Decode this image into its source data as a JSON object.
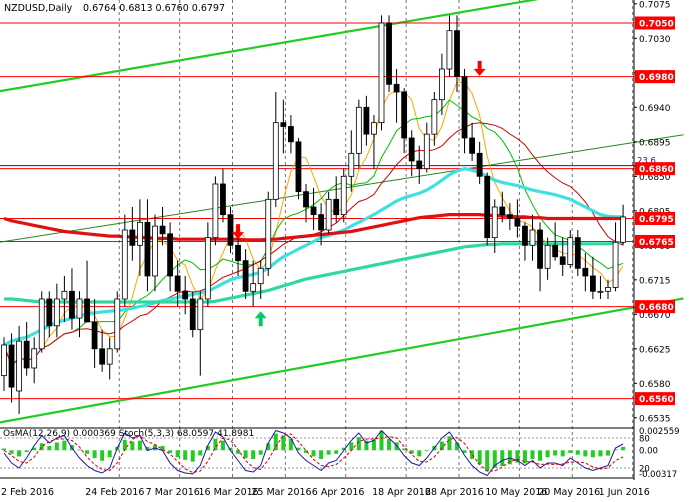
{
  "chart_data": {
    "type": "candlestick",
    "symbol_label": "NZDUSD,Daily",
    "ohlc_label": "0.6764 0.6813 0.6760 0.6797",
    "price_axis": {
      "range": [
        0.6523,
        0.708
      ],
      "ticks": [
        "0.7075",
        "0.7030",
        "0.6985",
        "0.6940",
        "0.6895",
        "0.6850",
        "0.6805",
        "0.6760",
        "0.6715",
        "0.6670",
        "0.6625",
        "0.6580",
        "0.6535"
      ],
      "tick_values": [
        0.7075,
        0.703,
        0.6985,
        0.694,
        0.6895,
        0.685,
        0.6805,
        0.676,
        0.6715,
        0.667,
        0.6625,
        0.658,
        0.6535
      ]
    },
    "date_axis": {
      "labels": [
        "2 Feb 2016",
        "24 Feb 2016",
        "7 Mar 2016",
        "16 Mar 2016",
        "25 Mar 2016",
        "6 Apr 2016",
        "18 Apr 2016",
        "28 Apr 2016",
        "10 May 2016",
        "20 May 2016",
        "1 Jun 2016"
      ],
      "label_bars": [
        0,
        15,
        23,
        30,
        37,
        45,
        53,
        60,
        68,
        75,
        83
      ]
    },
    "levels": [
      {
        "value": 0.705,
        "label": "0.7050",
        "color": "#ff0000"
      },
      {
        "value": 0.698,
        "label": "0.6980",
        "color": "#ff0000"
      },
      {
        "value": 0.686,
        "label": "0.6860",
        "color": "#ff0000"
      },
      {
        "value": 0.6795,
        "label": "0.6795",
        "color": "#ff0000"
      },
      {
        "value": 0.6765,
        "label": "0.6765",
        "color": "#ff0000"
      },
      {
        "value": 0.668,
        "label": "0.6680",
        "color": "#ff0000"
      },
      {
        "value": 0.656,
        "label": "0.6560",
        "color": "#ff0000"
      }
    ],
    "fibo": {
      "value": 0.6864,
      "label": "23.6",
      "color": "#1a1aa8"
    },
    "signals": [
      {
        "type": "sell",
        "bar": 31,
        "value": 0.6772,
        "color": "#ff0000"
      },
      {
        "type": "sell",
        "bar": 63,
        "value": 0.6985,
        "color": "#ff0000"
      },
      {
        "type": "buy",
        "bar": 34,
        "value": 0.667,
        "color": "#00cc66"
      }
    ],
    "candles": [
      [
        0.659,
        0.664,
        0.657,
        0.663
      ],
      [
        0.663,
        0.6645,
        0.6555,
        0.6575
      ],
      [
        0.657,
        0.6655,
        0.654,
        0.6635
      ],
      [
        0.6635,
        0.666,
        0.659,
        0.66
      ],
      [
        0.66,
        0.664,
        0.658,
        0.6625
      ],
      [
        0.6625,
        0.67,
        0.662,
        0.669
      ],
      [
        0.669,
        0.67,
        0.664,
        0.6655
      ],
      [
        0.6655,
        0.671,
        0.664,
        0.669
      ],
      [
        0.669,
        0.672,
        0.666,
        0.67
      ],
      [
        0.67,
        0.673,
        0.665,
        0.6665
      ],
      [
        0.6665,
        0.67,
        0.664,
        0.669
      ],
      [
        0.669,
        0.674,
        0.666,
        0.666
      ],
      [
        0.666,
        0.669,
        0.66,
        0.6625
      ],
      [
        0.6625,
        0.665,
        0.6595,
        0.6605
      ],
      [
        0.6605,
        0.664,
        0.6585,
        0.6625
      ],
      [
        0.6625,
        0.67,
        0.662,
        0.669
      ],
      [
        0.669,
        0.68,
        0.668,
        0.678
      ],
      [
        0.678,
        0.681,
        0.674,
        0.676
      ],
      [
        0.676,
        0.682,
        0.672,
        0.679
      ],
      [
        0.679,
        0.682,
        0.67,
        0.672
      ],
      [
        0.672,
        0.68,
        0.67,
        0.6785
      ],
      [
        0.6785,
        0.681,
        0.676,
        0.6775
      ],
      [
        0.6775,
        0.679,
        0.67,
        0.672
      ],
      [
        0.672,
        0.674,
        0.668,
        0.67
      ],
      [
        0.67,
        0.672,
        0.667,
        0.669
      ],
      [
        0.669,
        0.67,
        0.664,
        0.665
      ],
      [
        0.665,
        0.67,
        0.659,
        0.669
      ],
      [
        0.669,
        0.679,
        0.668,
        0.677
      ],
      [
        0.677,
        0.685,
        0.676,
        0.684
      ],
      [
        0.684,
        0.686,
        0.679,
        0.68
      ],
      [
        0.68,
        0.681,
        0.675,
        0.676
      ],
      [
        0.676,
        0.678,
        0.672,
        0.674
      ],
      [
        0.674,
        0.6755,
        0.669,
        0.67
      ],
      [
        0.67,
        0.674,
        0.668,
        0.671
      ],
      [
        0.671,
        0.674,
        0.669,
        0.673
      ],
      [
        0.673,
        0.683,
        0.672,
        0.682
      ],
      [
        0.682,
        0.696,
        0.681,
        0.692
      ],
      [
        0.692,
        0.695,
        0.688,
        0.6915
      ],
      [
        0.6915,
        0.693,
        0.688,
        0.6895
      ],
      [
        0.6895,
        0.69,
        0.682,
        0.683
      ],
      [
        0.683,
        0.684,
        0.679,
        0.681
      ],
      [
        0.681,
        0.6835,
        0.678,
        0.68
      ],
      [
        0.68,
        0.6815,
        0.676,
        0.678
      ],
      [
        0.678,
        0.683,
        0.6775,
        0.682
      ],
      [
        0.682,
        0.685,
        0.679,
        0.68
      ],
      [
        0.68,
        0.686,
        0.679,
        0.685
      ],
      [
        0.685,
        0.691,
        0.683,
        0.688
      ],
      [
        0.688,
        0.695,
        0.686,
        0.694
      ],
      [
        0.694,
        0.6955,
        0.689,
        0.6905
      ],
      [
        0.6905,
        0.693,
        0.686,
        0.692
      ],
      [
        0.692,
        0.706,
        0.691,
        0.705
      ],
      [
        0.705,
        0.706,
        0.696,
        0.697
      ],
      [
        0.697,
        0.699,
        0.692,
        0.696
      ],
      [
        0.696,
        0.6965,
        0.688,
        0.69
      ],
      [
        0.69,
        0.691,
        0.685,
        0.687
      ],
      [
        0.687,
        0.689,
        0.684,
        0.686
      ],
      [
        0.686,
        0.692,
        0.6855,
        0.6905
      ],
      [
        0.6905,
        0.696,
        0.689,
        0.695
      ],
      [
        0.695,
        0.701,
        0.693,
        0.699
      ],
      [
        0.699,
        0.706,
        0.698,
        0.704
      ],
      [
        0.704,
        0.706,
        0.696,
        0.698
      ],
      [
        0.698,
        0.699,
        0.688,
        0.69
      ],
      [
        0.69,
        0.692,
        0.687,
        0.688
      ],
      [
        0.688,
        0.6895,
        0.684,
        0.685
      ],
      [
        0.685,
        0.6855,
        0.676,
        0.677
      ],
      [
        0.677,
        0.682,
        0.675,
        0.681
      ],
      [
        0.681,
        0.683,
        0.679,
        0.68
      ],
      [
        0.68,
        0.6815,
        0.678,
        0.6795
      ],
      [
        0.6795,
        0.682,
        0.677,
        0.6785
      ],
      [
        0.6785,
        0.679,
        0.674,
        0.676
      ],
      [
        0.676,
        0.68,
        0.674,
        0.678
      ],
      [
        0.678,
        0.679,
        0.67,
        0.673
      ],
      [
        0.673,
        0.677,
        0.6715,
        0.676
      ],
      [
        0.676,
        0.679,
        0.674,
        0.6745
      ],
      [
        0.6745,
        0.677,
        0.672,
        0.6735
      ],
      [
        0.6735,
        0.678,
        0.673,
        0.677
      ],
      [
        0.677,
        0.678,
        0.672,
        0.673
      ],
      [
        0.673,
        0.675,
        0.67,
        0.672
      ],
      [
        0.672,
        0.6745,
        0.669,
        0.67
      ],
      [
        0.67,
        0.672,
        0.669,
        0.67
      ],
      [
        0.67,
        0.6715,
        0.669,
        0.6705
      ],
      [
        0.6705,
        0.679,
        0.67,
        0.6764
      ],
      [
        0.6764,
        0.6813,
        0.676,
        0.6797
      ]
    ],
    "ma_series": [
      {
        "color": "#ffa500",
        "period": 5
      },
      {
        "color": "#00c000",
        "period": 10
      },
      {
        "color": "#d00000",
        "period": 20
      },
      {
        "color": "#40e0e0",
        "period": 50,
        "points": [
          0.663,
          0.6635,
          0.6638,
          0.664,
          0.6645,
          0.665,
          0.6655,
          0.666,
          0.6662,
          0.6665,
          0.6668,
          0.667,
          0.6672,
          0.6673,
          0.6674,
          0.6675,
          0.6676,
          0.6678,
          0.668,
          0.6682,
          0.6685,
          0.6688,
          0.669,
          0.6692,
          0.6694,
          0.6696,
          0.6698,
          0.67,
          0.6705,
          0.671,
          0.6715,
          0.6718,
          0.672,
          0.6722,
          0.6725,
          0.673,
          0.6738,
          0.6745,
          0.675,
          0.6755,
          0.676,
          0.6765,
          0.677,
          0.6773,
          0.6776,
          0.678,
          0.6785,
          0.679,
          0.6795,
          0.68,
          0.6806,
          0.6812,
          0.6818,
          0.6822,
          0.6825,
          0.6828,
          0.6832,
          0.6838,
          0.6845,
          0.6852,
          0.6857,
          0.686,
          0.6858,
          0.6855,
          0.685,
          0.6845,
          0.6842,
          0.684,
          0.6838,
          0.6835,
          0.6832,
          0.683,
          0.6828,
          0.6826,
          0.6823,
          0.682,
          0.6815,
          0.681,
          0.6805,
          0.68,
          0.6798,
          0.6797,
          0.6797
        ]
      },
      {
        "color": "#30d8a0",
        "period": 100,
        "points": [
          0.669,
          0.669,
          0.6689,
          0.6688,
          0.6687,
          0.6686,
          0.6686,
          0.6686,
          0.6686,
          0.6686,
          0.6686,
          0.6686,
          0.6686,
          0.6686,
          0.6686,
          0.6686,
          0.6686,
          0.6686,
          0.6686,
          0.6686,
          0.6686,
          0.6686,
          0.6686,
          0.6686,
          0.6686,
          0.6686,
          0.6686,
          0.6686,
          0.6687,
          0.6689,
          0.6691,
          0.6693,
          0.6695,
          0.6697,
          0.6699,
          0.6701,
          0.6704,
          0.6707,
          0.671,
          0.6713,
          0.6716,
          0.6718,
          0.672,
          0.6722,
          0.6724,
          0.6726,
          0.6728,
          0.673,
          0.6732,
          0.6734,
          0.6736,
          0.6738,
          0.674,
          0.6742,
          0.6744,
          0.6746,
          0.6748,
          0.675,
          0.6752,
          0.6754,
          0.6756,
          0.6758,
          0.6759,
          0.676,
          0.6761,
          0.6761,
          0.6762,
          0.6762,
          0.6762,
          0.6762,
          0.6762,
          0.6762,
          0.6762,
          0.6762,
          0.6762,
          0.6762,
          0.6762,
          0.6762,
          0.6762,
          0.6762,
          0.6762,
          0.6763,
          0.6764
        ]
      },
      {
        "color": "#e01010",
        "period": 200,
        "points": [
          0.6795,
          0.6792,
          0.679,
          0.6788,
          0.6786,
          0.6784,
          0.6782,
          0.678,
          0.6778,
          0.6777,
          0.6776,
          0.6775,
          0.6774,
          0.6773,
          0.6772,
          0.6772,
          0.6771,
          0.6771,
          0.677,
          0.677,
          0.6769,
          0.6769,
          0.6769,
          0.6768,
          0.6768,
          0.6768,
          0.6768,
          0.6768,
          0.6768,
          0.6768,
          0.6768,
          0.6768,
          0.6767,
          0.6767,
          0.6767,
          0.6768,
          0.6768,
          0.6769,
          0.677,
          0.6771,
          0.6772,
          0.6773,
          0.6774,
          0.6775,
          0.6776,
          0.6777,
          0.6778,
          0.678,
          0.6782,
          0.6784,
          0.6786,
          0.6788,
          0.679,
          0.6792,
          0.6794,
          0.6796,
          0.6797,
          0.6798,
          0.6799,
          0.68,
          0.68,
          0.68,
          0.68,
          0.68,
          0.6799,
          0.6799,
          0.6798,
          0.6798,
          0.6797,
          0.6797,
          0.6796,
          0.6796,
          0.6795,
          0.6795,
          0.6795,
          0.6795,
          0.6795,
          0.6795,
          0.6795,
          0.6795,
          0.6795,
          0.6795,
          0.6795
        ]
      }
    ],
    "channel_lines": [
      {
        "name": "upper",
        "color": "#22cc22",
        "from": [
          0,
          0.6962
        ],
        "to": [
          70,
          0.708
        ]
      },
      {
        "name": "lower",
        "color": "#22cc22",
        "from": [
          0,
          0.653
        ],
        "to": [
          84,
          0.668
        ]
      },
      {
        "name": "mid",
        "color": "#228822",
        "from": [
          0,
          0.6765
        ],
        "to": [
          84,
          0.6895
        ]
      }
    ],
    "indicator": {
      "label": "OsMA(12,26,9) 0.000369  Stoch(5,3,3) 68.0597 41.8981",
      "osma_range": [
        -0.00317,
        0.00255
      ],
      "ticks": [
        "0.002559",
        "80",
        "20",
        "0.00",
        "-0.00317"
      ],
      "osma": [
        0.0002,
        -0.0004,
        -0.0007,
        -0.0002,
        0.0003,
        0.0008,
        0.0005,
        0.0009,
        0.0011,
        0.0006,
        0.0001,
        -0.0004,
        -0.0009,
        -0.0012,
        -0.0008,
        0.0004,
        0.0012,
        0.001,
        0.0011,
        0.0004,
        0.0006,
        0.0005,
        -0.0003,
        -0.0008,
        -0.0011,
        -0.0013,
        -0.0006,
        0.0005,
        0.0013,
        0.0011,
        0.0003,
        -0.0004,
        -0.0009,
        -0.001,
        -0.0005,
        0.0008,
        0.0019,
        0.0017,
        0.0013,
        0.0003,
        -0.0003,
        -0.0007,
        -0.001,
        -0.0005,
        -0.0004,
        0.0003,
        0.0009,
        0.0015,
        0.0011,
        0.0012,
        0.0022,
        0.0013,
        0.0009,
        0.0002,
        -0.0004,
        -0.0007,
        -0.0001,
        0.0005,
        0.001,
        0.0016,
        0.0009,
        -0.0003,
        -0.001,
        -0.0016,
        -0.0024,
        -0.002,
        -0.0018,
        -0.0016,
        -0.0014,
        -0.0015,
        -0.001,
        -0.0012,
        -0.0008,
        -0.0006,
        -0.0007,
        -0.0003,
        -0.0005,
        -0.0007,
        -0.0008,
        -0.0007,
        -0.0006,
        0.0001,
        0.0004
      ],
      "stoch_main": [
        50,
        30,
        20,
        40,
        65,
        85,
        70,
        80,
        85,
        60,
        40,
        25,
        15,
        10,
        20,
        60,
        90,
        80,
        85,
        55,
        60,
        55,
        30,
        15,
        10,
        8,
        25,
        65,
        92,
        82,
        55,
        35,
        15,
        12,
        25,
        70,
        95,
        90,
        80,
        50,
        35,
        25,
        15,
        30,
        35,
        55,
        75,
        90,
        70,
        75,
        95,
        80,
        65,
        45,
        30,
        25,
        40,
        60,
        80,
        92,
        70,
        45,
        25,
        12,
        5,
        25,
        35,
        40,
        35,
        25,
        35,
        20,
        30,
        30,
        25,
        40,
        30,
        20,
        15,
        20,
        25,
        60,
        68
      ],
      "stoch_signal": [
        55,
        45,
        33,
        30,
        42,
        63,
        73,
        78,
        78,
        75,
        62,
        42,
        27,
        17,
        15,
        30,
        57,
        77,
        85,
        73,
        67,
        57,
        48,
        33,
        18,
        11,
        14,
        33,
        61,
        80,
        76,
        57,
        35,
        21,
        17,
        36,
        63,
        85,
        88,
        73,
        55,
        37,
        25,
        23,
        27,
        40,
        55,
        73,
        78,
        78,
        80,
        83,
        80,
        63,
        47,
        33,
        32,
        42,
        60,
        77,
        81,
        69,
        47,
        27,
        14,
        14,
        22,
        33,
        37,
        33,
        32,
        27,
        28,
        27,
        28,
        32,
        32,
        30,
        22,
        18,
        20,
        35,
        42
      ]
    }
  }
}
